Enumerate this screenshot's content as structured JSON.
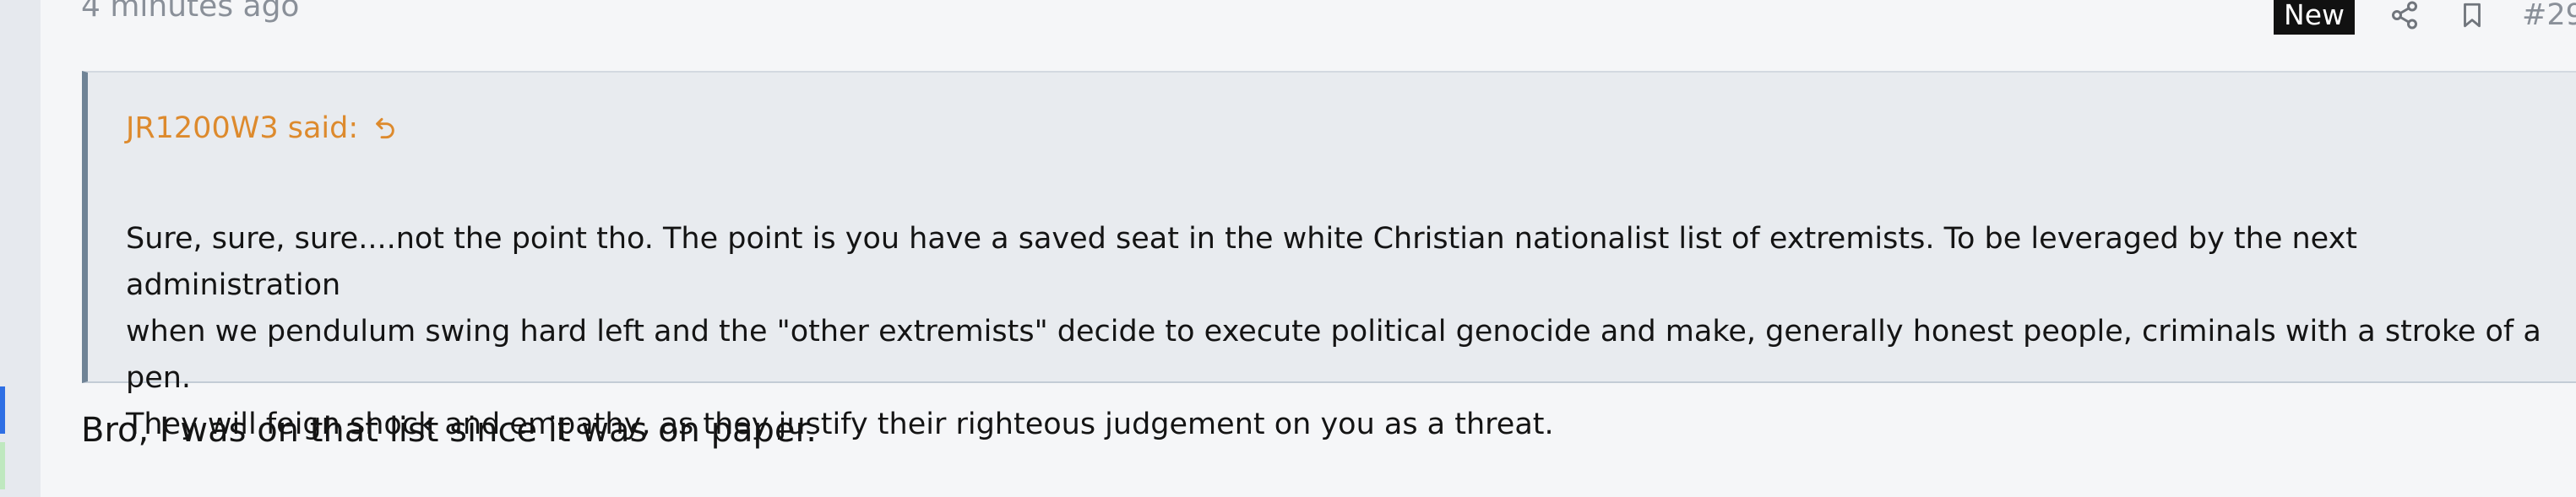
{
  "post": {
    "timestamp": "4 minutes ago",
    "new_badge": "New",
    "post_number": "#29",
    "quote": {
      "attribution": "JR1200W3 said:",
      "text": "Sure, sure, sure....not the point tho. The point is you have a saved seat in the white Christian nationalist list of extremists. To be leveraged by the next administration\nwhen we pendulum swing hard left and the \"other extremists\" decide to execute political genocide and make, generally honest people, criminals with a stroke of a pen.\nThey will feign shock and empathy, as they justify their righteous judgement on you as a threat."
    },
    "reply_text": "Bro, I was on that list since it was on paper."
  },
  "icons": {
    "share": "share-icon",
    "bookmark": "bookmark-icon",
    "quote_jump": "return-arrow-icon"
  },
  "colors": {
    "attribution": "#dd8a2d",
    "quote_border": "#6f8396",
    "new_badge_bg": "#111111",
    "selected_marker": "#2f6fe4",
    "secondary_marker": "#bfe8bf"
  }
}
